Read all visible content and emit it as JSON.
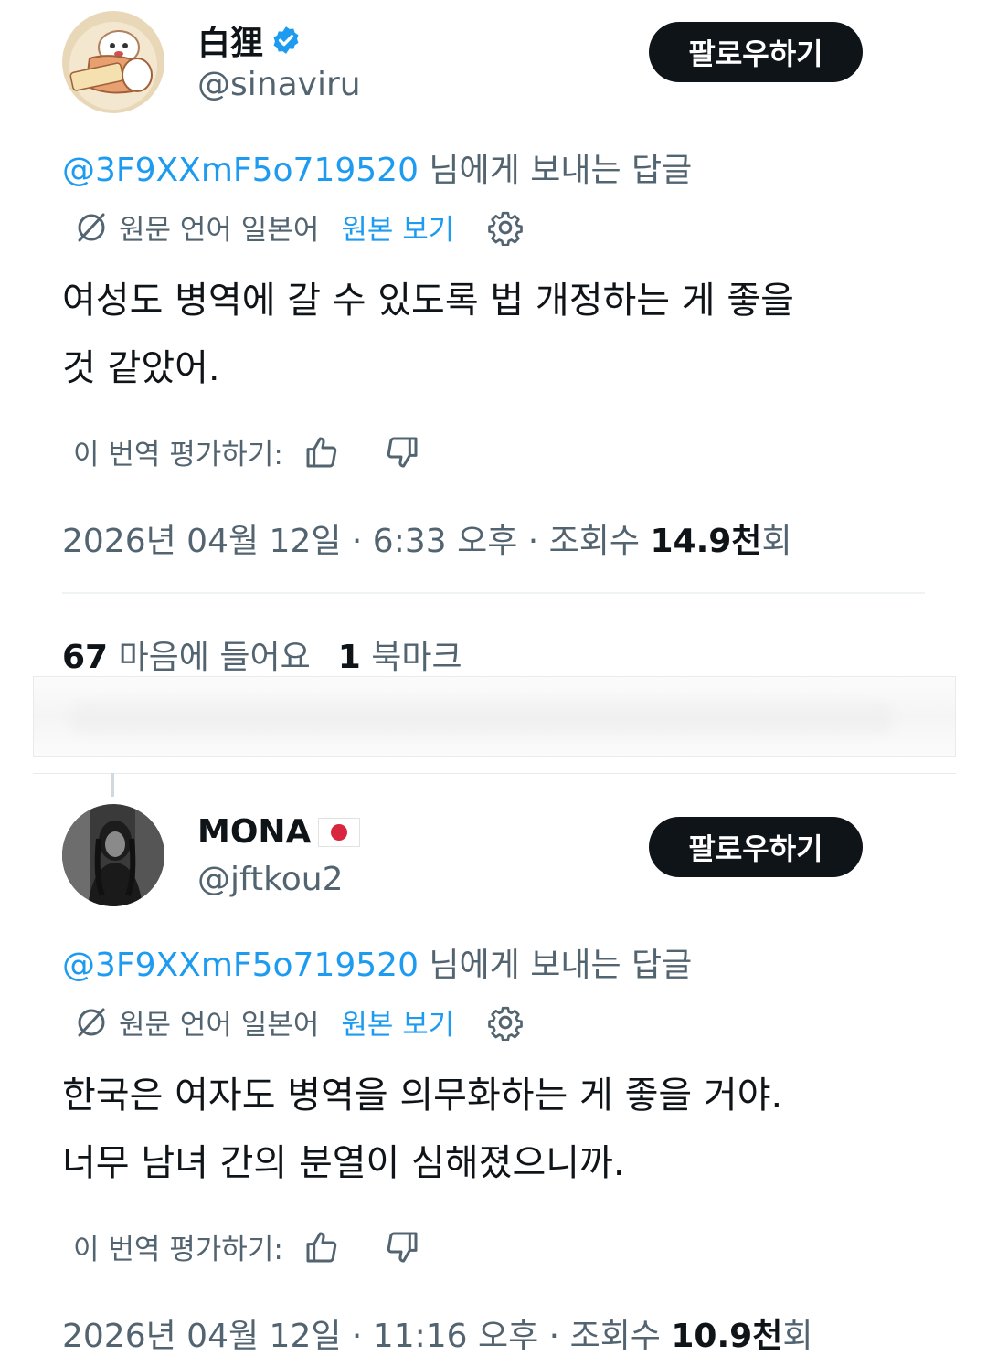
{
  "tweets": [
    {
      "display_name": "白狸",
      "verified": true,
      "handle": "@sinaviru",
      "follow_label": "팔로우하기",
      "reply_mention": "@3F9XXmF5o719520",
      "reply_suffix": " 님에게 보내는 답글",
      "source_language": "원문 언어 일본어",
      "show_original_label": "원본 보기",
      "body_lines": [
        "여성도 병역에 갈 수 있도록 법 개정하는 게 좋을",
        "것 같았어."
      ],
      "rate_label": "이 번역 평가하기:",
      "meta_prefix": "2026년 04월 12일 · 6:33 오후 · 조회수 ",
      "views": "14.9천",
      "views_suffix": "회",
      "likes_count": "67",
      "likes_label": "마음에 들어요",
      "bookmarks_count": "1",
      "bookmarks_label": "북마크"
    },
    {
      "display_name": "MONA",
      "flag": "japan-flag",
      "handle": "@jftkou2",
      "follow_label": "팔로우하기",
      "reply_mention": "@3F9XXmF5o719520",
      "reply_suffix": " 님에게 보내는 답글",
      "source_language": "원문 언어 일본어",
      "show_original_label": "원본 보기",
      "body_lines": [
        "한국은 여자도 병역을 의무화하는 게 좋을 거야.",
        "너무 남녀 간의 분열이 심해졌으니까."
      ],
      "rate_label": "이 번역 평가하기:",
      "meta_prefix": "2026년 04월 12일 · 11:16 오후 · 조회수 ",
      "views": "10.9천",
      "views_suffix": "회"
    }
  ],
  "colors": {
    "text": "#0f1419",
    "secondary": "#536471",
    "link": "#1d9bf0",
    "button_bg": "#0f1419",
    "verified": "#1d9bf0"
  },
  "icons": [
    "verified-badge-icon",
    "translate-icon",
    "gear-icon",
    "thumbs-up-icon",
    "thumbs-down-icon",
    "japan-flag"
  ]
}
